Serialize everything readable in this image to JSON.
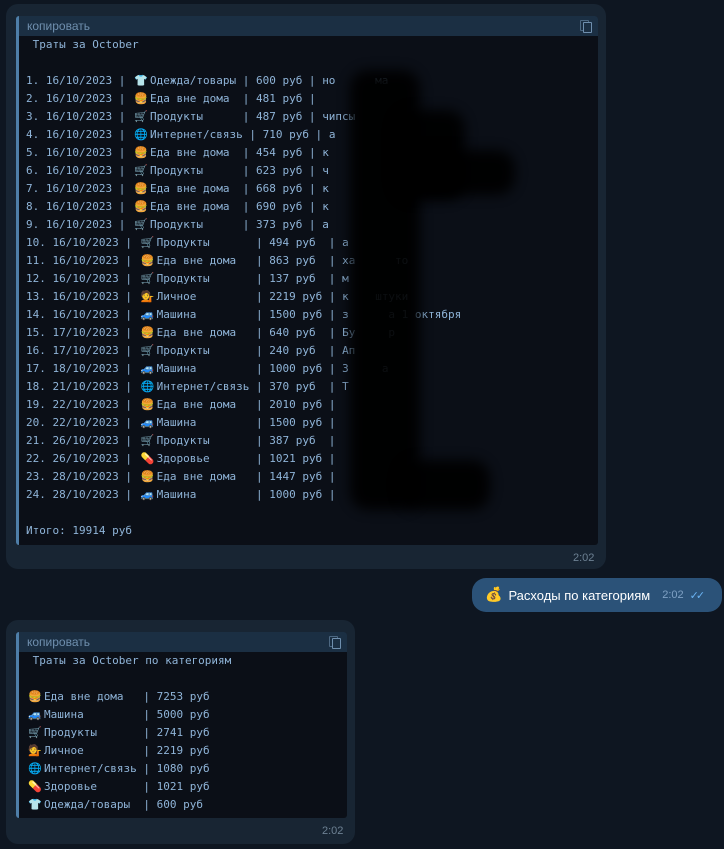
{
  "message1": {
    "copy_label": "копировать",
    "title": " Траты за October",
    "rows": [
      {
        "num": "1.",
        "date": "16/10/2023",
        "icon": "👕",
        "icon_name": "shirt-icon",
        "category": "Одежда/товары",
        "amount": "600 руб",
        "note": "но      ма"
      },
      {
        "num": "2.",
        "date": "16/10/2023",
        "icon": "🍔",
        "icon_name": "burger-icon",
        "category": "Еда вне дома",
        "amount": "481 руб",
        "note": ""
      },
      {
        "num": "3.",
        "date": "16/10/2023",
        "icon": "🛒",
        "icon_name": "cart-icon",
        "category": "Продукты",
        "amount": "487 руб",
        "note": "чипсы"
      },
      {
        "num": "4.",
        "date": "16/10/2023",
        "icon": "🌐",
        "icon_name": "globe-icon",
        "category": "Интернет/связь",
        "amount": "710 руб",
        "note": "а"
      },
      {
        "num": "5.",
        "date": "16/10/2023",
        "icon": "🍔",
        "icon_name": "burger-icon",
        "category": "Еда вне дома",
        "amount": "454 руб",
        "note": "к"
      },
      {
        "num": "6.",
        "date": "16/10/2023",
        "icon": "🛒",
        "icon_name": "cart-icon",
        "category": "Продукты",
        "amount": "623 руб",
        "note": "ч"
      },
      {
        "num": "7.",
        "date": "16/10/2023",
        "icon": "🍔",
        "icon_name": "burger-icon",
        "category": "Еда вне дома",
        "amount": "668 руб",
        "note": "к"
      },
      {
        "num": "8.",
        "date": "16/10/2023",
        "icon": "🍔",
        "icon_name": "burger-icon",
        "category": "Еда вне дома",
        "amount": "690 руб",
        "note": "к"
      },
      {
        "num": "9.",
        "date": "16/10/2023",
        "icon": "🛒",
        "icon_name": "cart-icon",
        "category": "Продукты",
        "amount": "373 руб",
        "note": "а"
      },
      {
        "num": "10.",
        "date": "16/10/2023",
        "icon": "🛒",
        "icon_name": "cart-icon",
        "category": "Продукты",
        "amount": "494 руб",
        "note": "а"
      },
      {
        "num": "11.",
        "date": "16/10/2023",
        "icon": "🍔",
        "icon_name": "burger-icon",
        "category": "Еда вне дома",
        "amount": "863 руб",
        "note": "ха      то"
      },
      {
        "num": "12.",
        "date": "16/10/2023",
        "icon": "🛒",
        "icon_name": "cart-icon",
        "category": "Продукты",
        "amount": "137 руб",
        "note": "м"
      },
      {
        "num": "13.",
        "date": "16/10/2023",
        "icon": "💁",
        "icon_name": "person-icon",
        "category": "Личное",
        "amount": "2219 руб",
        "note": "к    штуки"
      },
      {
        "num": "14.",
        "date": "16/10/2023",
        "icon": "🚙",
        "icon_name": "car-icon",
        "category": "Машина",
        "amount": "1500 руб",
        "note": "з      а 1 октября"
      },
      {
        "num": "15.",
        "date": "17/10/2023",
        "icon": "🍔",
        "icon_name": "burger-icon",
        "category": "Еда вне дома",
        "amount": "640 руб",
        "note": "Бу     р"
      },
      {
        "num": "16.",
        "date": "17/10/2023",
        "icon": "🛒",
        "icon_name": "cart-icon",
        "category": "Продукты",
        "amount": "240 руб",
        "note": "Ап"
      },
      {
        "num": "17.",
        "date": "18/10/2023",
        "icon": "🚙",
        "icon_name": "car-icon",
        "category": "Машина",
        "amount": "1000 руб",
        "note": "З     а"
      },
      {
        "num": "18.",
        "date": "21/10/2023",
        "icon": "🌐",
        "icon_name": "globe-icon",
        "category": "Интернет/связь",
        "amount": "370 руб",
        "note": "Т"
      },
      {
        "num": "19.",
        "date": "22/10/2023",
        "icon": "🍔",
        "icon_name": "burger-icon",
        "category": "Еда вне дома",
        "amount": "2010 руб",
        "note": ""
      },
      {
        "num": "20.",
        "date": "22/10/2023",
        "icon": "🚙",
        "icon_name": "car-icon",
        "category": "Машина",
        "amount": "1500 руб",
        "note": ""
      },
      {
        "num": "21.",
        "date": "26/10/2023",
        "icon": "🛒",
        "icon_name": "cart-icon",
        "category": "Продукты",
        "amount": "387 руб",
        "note": ""
      },
      {
        "num": "22.",
        "date": "26/10/2023",
        "icon": "💊",
        "icon_name": "pill-icon",
        "category": "Здоровье",
        "amount": "1021 руб",
        "note": ""
      },
      {
        "num": "23.",
        "date": "28/10/2023",
        "icon": "🍔",
        "icon_name": "burger-icon",
        "category": "Еда вне дома",
        "amount": "1447 руб",
        "note": ""
      },
      {
        "num": "24.",
        "date": "28/10/2023",
        "icon": "🚙",
        "icon_name": "car-icon",
        "category": "Машина",
        "amount": "1000 руб",
        "note": ""
      }
    ],
    "total": "Итого: 19914 руб",
    "time": "2:02"
  },
  "message2": {
    "icon": "💰",
    "icon_name": "money-bag-icon",
    "text": "Расходы по категориям",
    "time": "2:02",
    "read_mark": "✓✓"
  },
  "message3": {
    "copy_label": "копировать",
    "title": " Траты за October по категориям",
    "rows": [
      {
        "icon": "🍔",
        "icon_name": "burger-icon",
        "category": "Еда вне дома",
        "amount": "7253 руб"
      },
      {
        "icon": "🚙",
        "icon_name": "car-icon",
        "category": "Машина",
        "amount": "5000 руб"
      },
      {
        "icon": "🛒",
        "icon_name": "cart-icon",
        "category": "Продукты",
        "amount": "2741 руб"
      },
      {
        "icon": "💁",
        "icon_name": "person-icon",
        "category": "Личное",
        "amount": "2219 руб"
      },
      {
        "icon": "🌐",
        "icon_name": "globe-icon",
        "category": "Интернет/связь",
        "amount": "1080 руб"
      },
      {
        "icon": "💊",
        "icon_name": "pill-icon",
        "category": "Здоровье",
        "amount": "1021 руб"
      },
      {
        "icon": "👕",
        "icon_name": "shirt-icon",
        "category": "Одежда/товары",
        "amount": "600 руб"
      }
    ],
    "time": "2:02"
  },
  "colors": {
    "background": "#0e1621",
    "incoming_bubble": "#182533",
    "outgoing_bubble": "#2b5278",
    "code_bg": "#0b0f17",
    "code_text": "#8fb4d8",
    "accent": "#4e7ea8"
  }
}
